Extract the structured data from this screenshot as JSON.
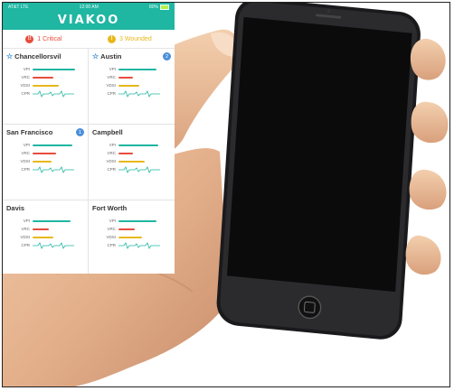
{
  "status": {
    "carrier": "AT&T LTE",
    "time": "12:00 AM",
    "battery": "80%"
  },
  "app": {
    "brand": "VIAKOO"
  },
  "alerts": {
    "critical": {
      "count_icon": "!!",
      "label": "1 Critical"
    },
    "wounded": {
      "count_icon": "!",
      "label": "3 Wounded"
    }
  },
  "metric_labels": [
    "VPI",
    "VRC",
    "VDSI",
    "CPR"
  ],
  "colors": {
    "teal": "#1fb6a2",
    "red": "#e84c3d",
    "yellow": "#e8b81a",
    "blue": "#4a90d9"
  },
  "sites": [
    {
      "name": "Chancellorsvil",
      "starred": true,
      "badge": "",
      "levels": [
        0.9,
        0.45,
        0.55,
        0.0
      ]
    },
    {
      "name": "Austin",
      "starred": true,
      "badge": "2",
      "levels": [
        0.8,
        0.3,
        0.45,
        0.0
      ]
    },
    {
      "name": "San Francisco",
      "starred": false,
      "badge": "1",
      "levels": [
        0.85,
        0.5,
        0.4,
        0.0
      ]
    },
    {
      "name": "Campbell",
      "starred": false,
      "badge": "",
      "levels": [
        0.85,
        0.3,
        0.55,
        0.0
      ]
    },
    {
      "name": "Davis",
      "starred": false,
      "badge": "",
      "levels": [
        0.8,
        0.35,
        0.45,
        0.0
      ]
    },
    {
      "name": "Fort Worth",
      "starred": false,
      "badge": "",
      "levels": [
        0.8,
        0.35,
        0.5,
        0.0
      ]
    }
  ]
}
